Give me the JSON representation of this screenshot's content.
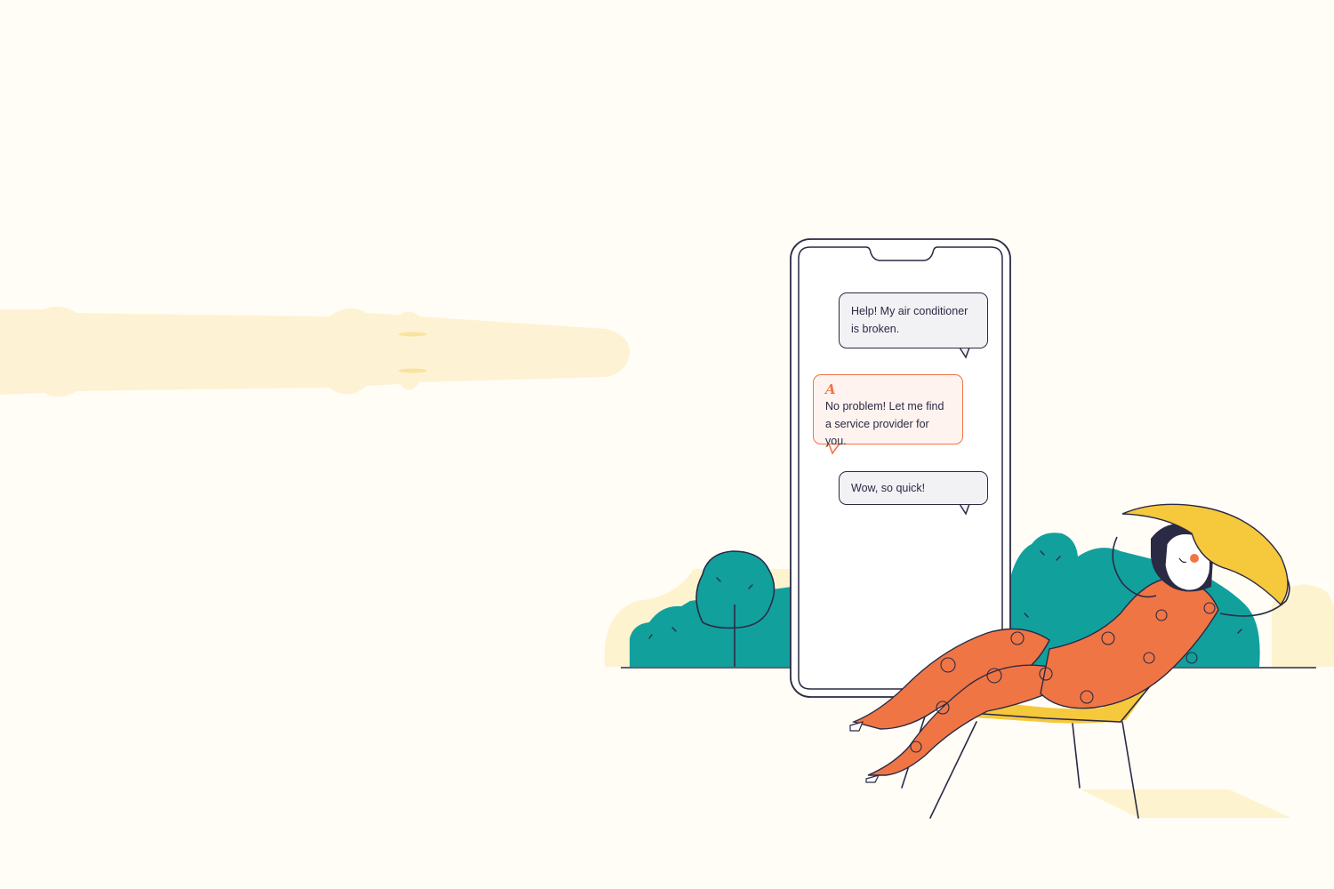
{
  "chat": {
    "messages": [
      {
        "sender": "user",
        "text": "Help! My air conditioner is broken."
      },
      {
        "sender": "assistant",
        "brand_mark": "A",
        "text": "No problem! Let me find a service provider for you."
      },
      {
        "sender": "user",
        "text": "Wow, so quick!"
      }
    ]
  },
  "colors": {
    "background": "#fffdf6",
    "outline": "#2b2a45",
    "assistant_accent": "#f07545",
    "bushes": "#12a09d",
    "outfit": "#f07545",
    "hat": "#f6c83c",
    "pale_yellow": "#fdf3cf"
  },
  "icons": [
    "assistant-brand-icon"
  ]
}
